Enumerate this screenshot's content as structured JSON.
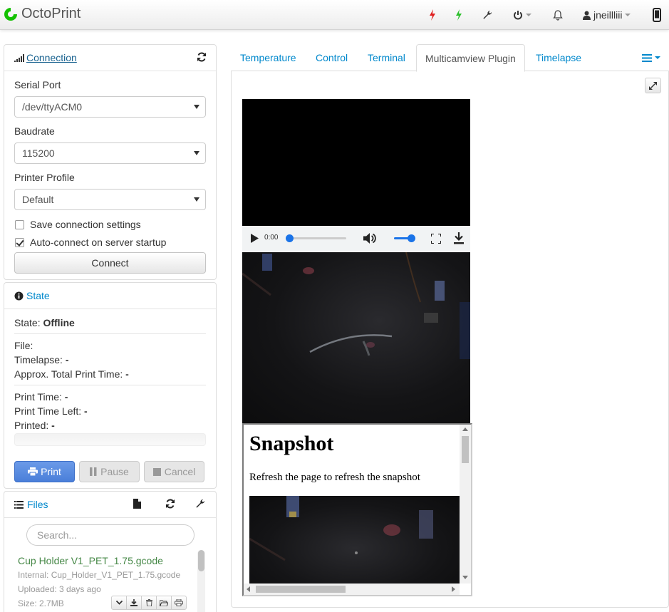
{
  "navbar": {
    "brand": "OctoPrint",
    "user": "jneillliii",
    "icons": [
      "flash-red-icon",
      "flash-green-icon",
      "wrench-icon",
      "power-icon",
      "bell-icon",
      "user-icon",
      "mobile-icon"
    ]
  },
  "connection": {
    "title": "Connection",
    "serial_port_label": "Serial Port",
    "serial_port_value": "/dev/ttyACM0",
    "baudrate_label": "Baudrate",
    "baudrate_value": "115200",
    "profile_label": "Printer Profile",
    "profile_value": "Default",
    "save_settings_label": "Save connection settings",
    "save_settings_checked": false,
    "autoconnect_label": "Auto-connect on server startup",
    "autoconnect_checked": true,
    "connect_button": "Connect"
  },
  "state": {
    "title": "State",
    "state_label": "State: ",
    "state_value": "Offline",
    "file_label": "File:",
    "timelapse_label": "Timelapse: ",
    "timelapse_value": "-",
    "approx_label": "Approx. Total Print Time: ",
    "approx_value": "-",
    "print_time_label": "Print Time: ",
    "print_time_value": "-",
    "time_left_label": "Print Time Left: ",
    "time_left_value": "-",
    "printed_label": "Printed: ",
    "printed_value": "-",
    "print_button": "Print",
    "pause_button": "Pause",
    "cancel_button": "Cancel"
  },
  "files": {
    "title": "Files",
    "search_placeholder": "Search...",
    "items": [
      {
        "name": "Cup Holder V1_PET_1.75.gcode",
        "internal": "Internal: Cup_Holder_V1_PET_1.75.gcode",
        "uploaded": "Uploaded: 3 days ago",
        "size": "Size: 2.7MB"
      }
    ]
  },
  "tabs": [
    "Temperature",
    "Control",
    "Terminal",
    "Multicamview Plugin",
    "Timelapse"
  ],
  "active_tab": "Multicamview Plugin",
  "video": {
    "time": "0:00",
    "progress": 0,
    "volume": 1
  },
  "snapshot": {
    "title": "Snapshot",
    "text": "Refresh the page to refresh the snapshot"
  },
  "colors": {
    "link": "#0088cc",
    "primary": "#4a7fd9",
    "file_green": "#468847"
  }
}
